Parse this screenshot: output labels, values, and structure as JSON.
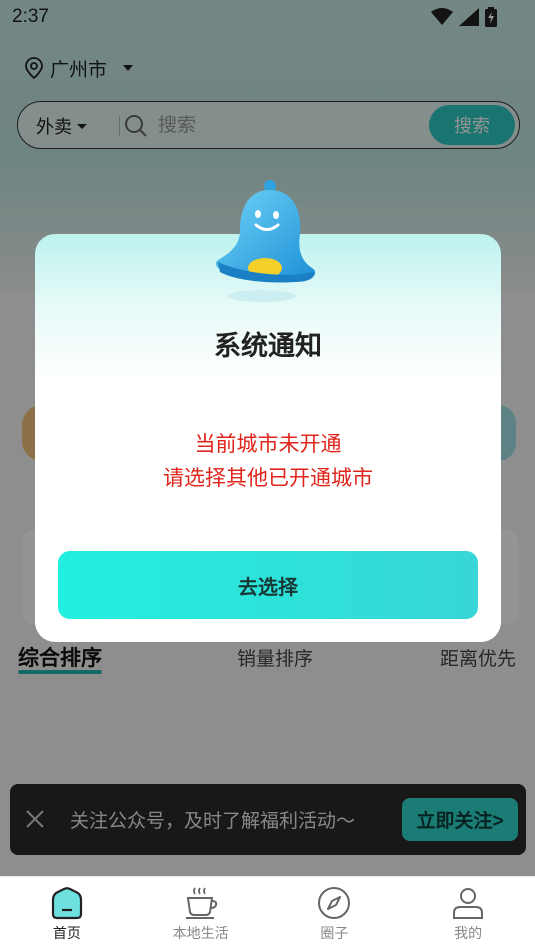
{
  "status_bar": {
    "time": "2:37",
    "icons": [
      "wifi-icon",
      "signal-icon",
      "battery-icon"
    ]
  },
  "location": {
    "city": "广州市",
    "icon": "location-pin-icon"
  },
  "search": {
    "category": "外卖",
    "placeholder": "搜索",
    "button_label": "搜索"
  },
  "sort_tabs": [
    {
      "label": "综合排序",
      "active": true
    },
    {
      "label": "销量排序",
      "active": false
    },
    {
      "label": "距离优先",
      "active": false
    }
  ],
  "follow_banner": {
    "text": "关注公众号，及时了解福利活动～",
    "button_label": "立即关注>"
  },
  "bottom_nav": [
    {
      "label": "首页",
      "icon": "home-icon",
      "active": true
    },
    {
      "label": "本地生活",
      "icon": "coffee-cup-icon",
      "active": false
    },
    {
      "label": "圈子",
      "icon": "compass-icon",
      "active": false
    },
    {
      "label": "我的",
      "icon": "user-icon",
      "active": false
    }
  ],
  "modal": {
    "title": "系统通知",
    "message_line1": "当前城市未开通",
    "message_line2": "请选择其他已开通城市",
    "button_label": "去选择",
    "icon": "bell-icon"
  },
  "colors": {
    "accent": "#2ec9c0",
    "alert_text": "#e0251b",
    "banner_bg": "#2a2a2a"
  }
}
